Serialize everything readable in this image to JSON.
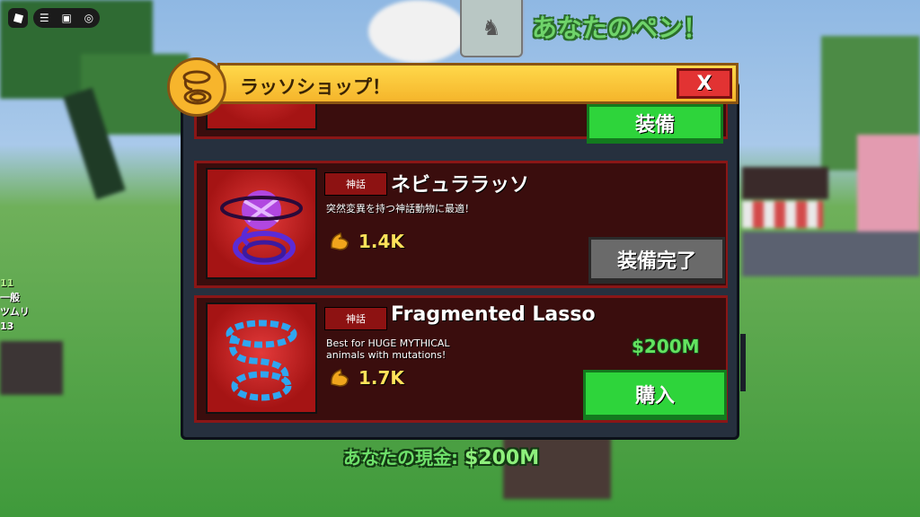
{
  "top": {
    "pen_title": "あなたのペン！"
  },
  "hud_left": {
    "count": "11",
    "rarity": "一般",
    "name": "ツムリ",
    "small": "13"
  },
  "shop": {
    "title": "ラッソショップ！",
    "close_label": "X",
    "items": [
      {
        "name": "",
        "tag": "",
        "desc": "",
        "power": "",
        "button": "装備",
        "button_state": "equip"
      },
      {
        "name": "ネビュララッソ",
        "tag": "神話",
        "desc": "突然変異を持つ神話動物に最適！",
        "power": "1.4K",
        "button": "装備完了",
        "button_state": "equipped"
      },
      {
        "name": "Fragmented Lasso",
        "tag": "神話",
        "desc_line1": "Best for HUGE MYTHICAL",
        "desc_line2": "animals with mutations!",
        "power": "1.7K",
        "price": "$200M",
        "button": "購入",
        "button_state": "buy"
      }
    ]
  },
  "cash": {
    "label": "あなたの現金:",
    "amount": "$200M"
  },
  "colors": {
    "accent_green": "#2ed43b",
    "header_yellow": "#ffd84a",
    "card_red": "#8a1616"
  }
}
